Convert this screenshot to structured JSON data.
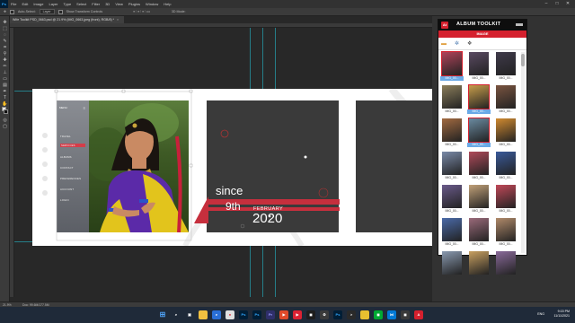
{
  "menubar": {
    "logo": "Ps",
    "items": [
      "File",
      "Edit",
      "Image",
      "Layer",
      "Type",
      "Select",
      "Filter",
      "3D",
      "View",
      "Plugins",
      "Window",
      "Help"
    ]
  },
  "optbar": {
    "auto_select": "Auto-Select:",
    "layer": "Layer",
    "show_transform": "Show Transform Controls",
    "mode_3d": "3D Mode:"
  },
  "document_tab": {
    "title": "Wife Toolkit PSD_0663.psd @ 21.9% (IMG_0663.jpeg (front), RGB/8) *"
  },
  "canvas": {
    "menu_label": "MENU",
    "nav_items": [
      "TRAVEL",
      "SERVICES",
      "ALBUMS",
      "CONTACT",
      "PREFERENCES",
      "ACCOUNT",
      "LOGIN"
    ],
    "active_nav": "SERVICES",
    "since": "since",
    "day": "9th",
    "month": "FEBRUARY",
    "year": "2020"
  },
  "statusbar": {
    "zoom": "21.9%",
    "doc_info": "Doc: 99.6M/177.5M"
  },
  "panel": {
    "logo": "At",
    "title": "ALBUM TOOLKIT",
    "tab": "IMAGE",
    "thumbnails": [
      {
        "label": "IMG_00...",
        "color": "#b0435a",
        "selected": true
      },
      {
        "label": "IMG_00...",
        "color": "#5a4a62"
      },
      {
        "label": "IMG_00...",
        "color": "#3f3a4a"
      },
      {
        "label": "IMG_00...",
        "color": "#8a7d5a"
      },
      {
        "label": "IMG_00...",
        "color": "#c69c4a",
        "selected": true
      },
      {
        "label": "IMG_00...",
        "color": "#7a5440"
      },
      {
        "label": "IMG_00...",
        "color": "#a26a40"
      },
      {
        "label": "IMG_00...",
        "color": "#6a8aa0",
        "selected": true
      },
      {
        "label": "IMG_00...",
        "color": "#d08a30"
      },
      {
        "label": "IMG_00...",
        "color": "#7a8aa8"
      },
      {
        "label": "IMG_00...",
        "color": "#b04a5a"
      },
      {
        "label": "IMG_00...",
        "color": "#3a5a9a"
      },
      {
        "label": "IMG_00...",
        "color": "#6a5a8a"
      },
      {
        "label": "IMG_00...",
        "color": "#c0a078"
      },
      {
        "label": "IMG_00...",
        "color": "#c04858"
      },
      {
        "label": "IMG_00...",
        "color": "#4a6aa8"
      },
      {
        "label": "IMG_00...",
        "color": "#9a6a7a"
      },
      {
        "label": "IMG_00...",
        "color": "#b08a6a"
      },
      {
        "label": "IMG_00...",
        "color": "#8a9ab0"
      },
      {
        "label": "IMG_00...",
        "color": "#c8a060"
      },
      {
        "label": "IMG_00...",
        "color": "#8a6a9a"
      }
    ]
  },
  "tray": {
    "lang": "ENG",
    "time": "9:15 PM",
    "date": "11/11/2021"
  },
  "colors": {
    "accent_red": "#d5202e",
    "ps_bg": "#282828",
    "taskbar": "#1f2a39"
  }
}
